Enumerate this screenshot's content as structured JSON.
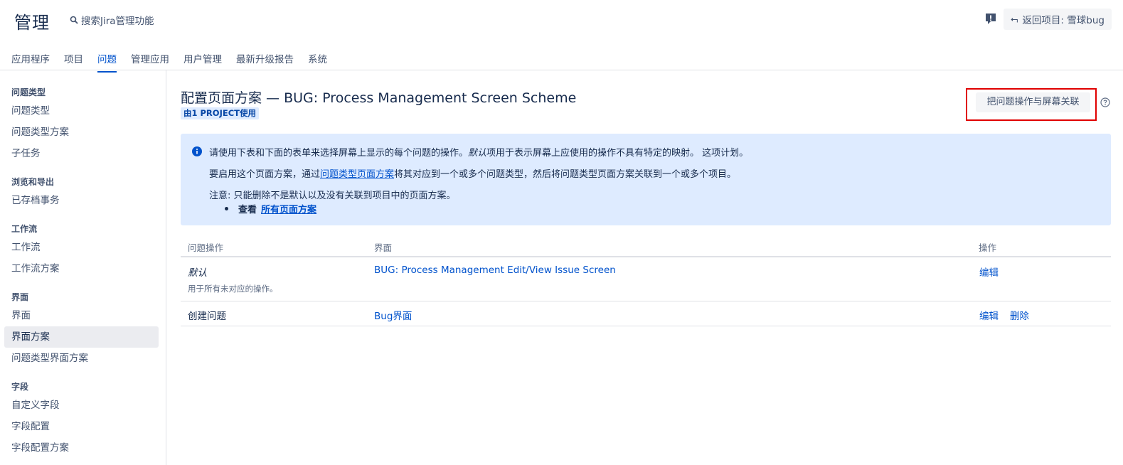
{
  "header": {
    "title": "管理",
    "search_label": "搜索Jira管理功能",
    "back_button": "返回项目: 雪球bug"
  },
  "tabs": [
    {
      "label": "应用程序"
    },
    {
      "label": "项目"
    },
    {
      "label": "问题",
      "active": true
    },
    {
      "label": "管理应用"
    },
    {
      "label": "用户管理"
    },
    {
      "label": "最新升级报告"
    },
    {
      "label": "系统"
    }
  ],
  "sidebar": {
    "sections": [
      {
        "title": "问题类型",
        "items": [
          "问题类型",
          "问题类型方案",
          "子任务"
        ]
      },
      {
        "title": "浏览和导出",
        "items": [
          "已存档事务"
        ]
      },
      {
        "title": "工作流",
        "items": [
          "工作流",
          "工作流方案"
        ]
      },
      {
        "title": "界面",
        "items": [
          "界面",
          "界面方案",
          "问题类型界面方案"
        ]
      },
      {
        "title": "字段",
        "items": [
          "自定义字段",
          "字段配置",
          "字段配置方案"
        ]
      }
    ],
    "active_item": "界面方案"
  },
  "main": {
    "title": "配置页面方案 — BUG: Process Management Screen Scheme",
    "usage_badge": "由1 PROJECT使用",
    "associate_button": "把问题操作与屏幕关联",
    "info": {
      "line1_a": "请使用下表和下面的表单来选择屏幕上显示的每个问题的操作。",
      "line1_em": "默认",
      "line1_b": "项用于表示屏幕上应使用的操作不具有特定的映射。 这项计划。",
      "line2_a": "要启用这个页面方案，通过",
      "line2_link": "问题类型页面方案",
      "line2_b": "将其对应到一个或多个问题类型，然后将问题类型页面方案关联到一个或多个项目。",
      "line3": "注意: 只能删除不是默认以及没有关联到项目中的页面方案。",
      "bullet_prefix": "查看",
      "bullet_link": "所有页面方案"
    },
    "table": {
      "headers": {
        "operation": "问题操作",
        "screen": "界面",
        "actions": "操作"
      },
      "rows": [
        {
          "operation": "默认",
          "operation_note": "用于所有未对应的操作。",
          "screen": "BUG: Process Management Edit/View Issue Screen",
          "edit": "编辑"
        },
        {
          "operation": "创建问题",
          "screen": "Bug界面",
          "edit": "编辑",
          "delete": "删除"
        }
      ]
    }
  }
}
